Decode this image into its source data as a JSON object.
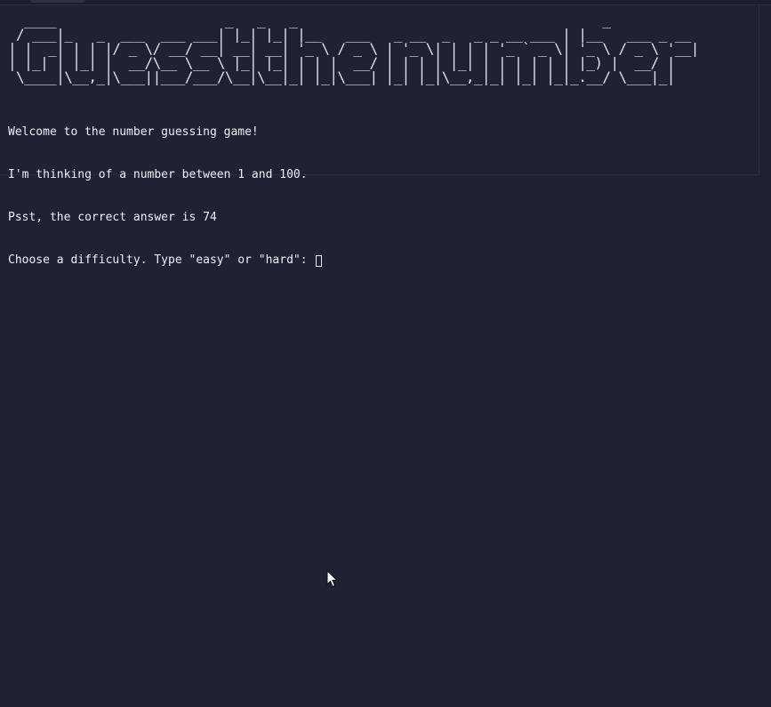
{
  "terminal": {
    "banner_lines": [
      "  ____                     _   _   _                                      _",
      " / ___|_   _  ___  ___ ___| |_| |_| |__   ___   _ __  _   _ _ __ ___ | |__   ___ _ __",
      "| |  _| | | |/ _ \\/ __/ __| __| __| '_ \\ / _ \\ | '_ \\| | | | '_ ` _ \\| '_ \\ / _ \\ '__|",
      "| |_| | |_| |  __/\\__ \\__ \\ |_| |_| | | |  __/ | | | | |_| | | | | | | |_) |  __/ |",
      " \\____|\\__,_|\\___||___/___/\\__|\\__|_| |_|\\___| |_| |_|\\__,_|_| |_| |_|_.__/ \\___|_|"
    ],
    "output_lines": [
      "Welcome to the number guessing game!",
      "I'm thinking of a number between 1 and 100.",
      "Psst, the correct answer is 74"
    ],
    "prompt": "Choose a difficulty. Type \"easy\" or \"hard\": ",
    "input_value": ""
  },
  "icons": {
    "pointer": "mouse-pointer-icon"
  },
  "colors": {
    "background": "#1e2232",
    "text": "#eef0f5"
  }
}
